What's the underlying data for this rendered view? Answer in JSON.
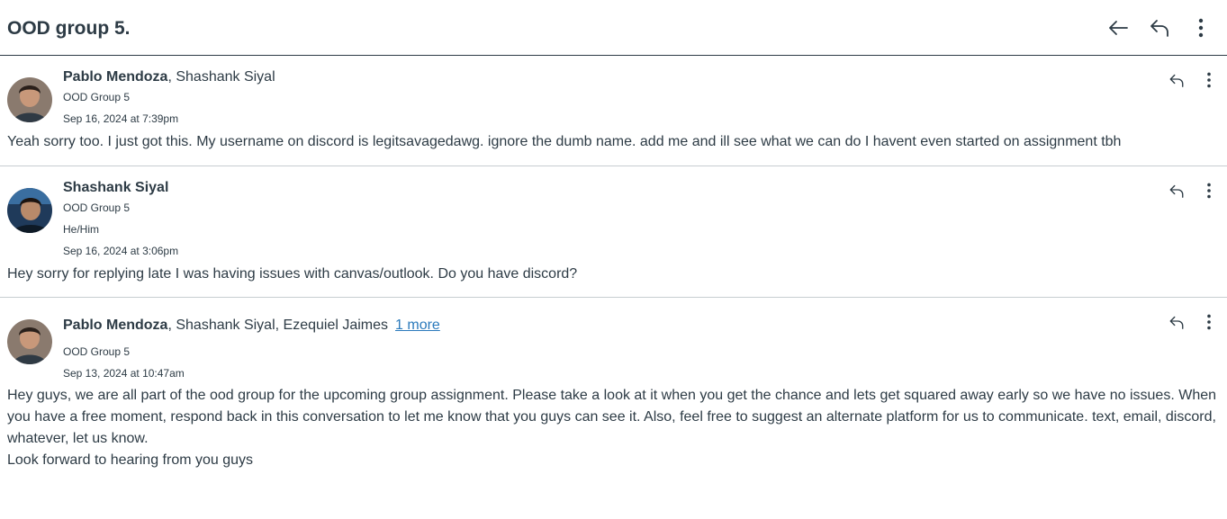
{
  "header": {
    "title": "OOD group 5.",
    "icons": [
      "arrow-left-icon",
      "reply-icon",
      "more-vertical-icon"
    ]
  },
  "messages": [
    {
      "author": "Pablo Mendoza",
      "recipients": ", Shashank Siyal",
      "more_link": "",
      "group": "OOD Group 5",
      "pronouns": "",
      "date": "Sep 16, 2024 at 7:39pm",
      "body": [
        "Yeah sorry too. I just got this. My username on discord is legitsavagedawg. ignore the dumb name. add me and ill see what we can do I havent even started on assignment tbh"
      ]
    },
    {
      "author": "Shashank Siyal",
      "recipients": "",
      "more_link": "",
      "group": "OOD Group 5",
      "pronouns": "He/Him",
      "date": "Sep 16, 2024 at 3:06pm",
      "body": [
        "Hey sorry for replying late I was having issues with canvas/outlook. Do you have discord?"
      ]
    },
    {
      "author": "Pablo Mendoza",
      "recipients": ", Shashank Siyal, Ezequiel Jaimes",
      "more_link": "1 more",
      "group": "OOD Group 5",
      "pronouns": "",
      "date": "Sep 13, 2024 at 10:47am",
      "body": [
        "Hey guys, we are all part of the ood group for the upcoming group assignment. Please take a look at it when you get the chance and lets get squared away early so we have no issues. When you have a free moment, respond back in this conversation to let me know that you guys can see it. Also, feel free to suggest an alternate platform for us to communicate. text, email, discord, whatever, let us know.",
        "Look forward to hearing from you guys"
      ]
    }
  ]
}
